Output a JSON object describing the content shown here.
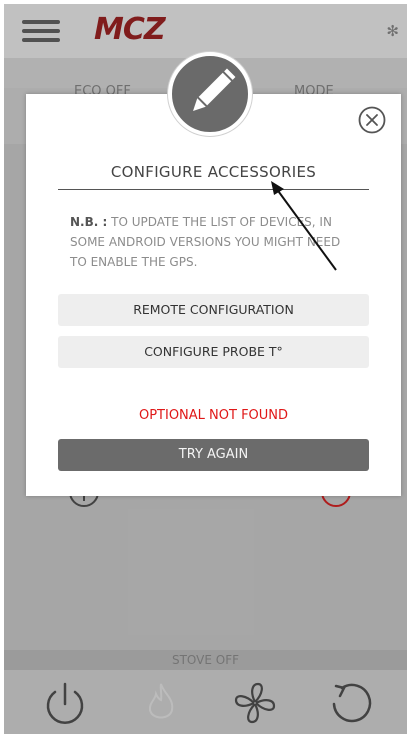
{
  "header": {
    "brand": "MCZ",
    "brand_color": "#8a1818"
  },
  "modes": {
    "left": "ECO OFF",
    "right": "MODE"
  },
  "footer": {
    "stove_status": "STOVE OFF"
  },
  "dialog": {
    "title": "CONFIGURE ACCESSORIES",
    "note_prefix": "N.B. :",
    "note_text": " TO UPDATE THE LIST OF DEVICES, IN SOME ANDROID VERSIONS YOU MIGHT NEED TO ENABLE THE GPS.",
    "remote_button": "REMOTE CONFIGURATION",
    "probe_button": "CONFIGURE PROBE T°",
    "status": "OPTIONAL NOT FOUND",
    "status_color": "#e01818",
    "retry_button": "TRY AGAIN"
  },
  "icons": {
    "menu": "hamburger-menu-icon",
    "snow": "snowflake-icon",
    "edit": "pencil-icon",
    "close": "close-icon",
    "power": "power-icon",
    "flame": "flame-icon",
    "fan": "fan-icon",
    "refresh": "refresh-icon"
  }
}
